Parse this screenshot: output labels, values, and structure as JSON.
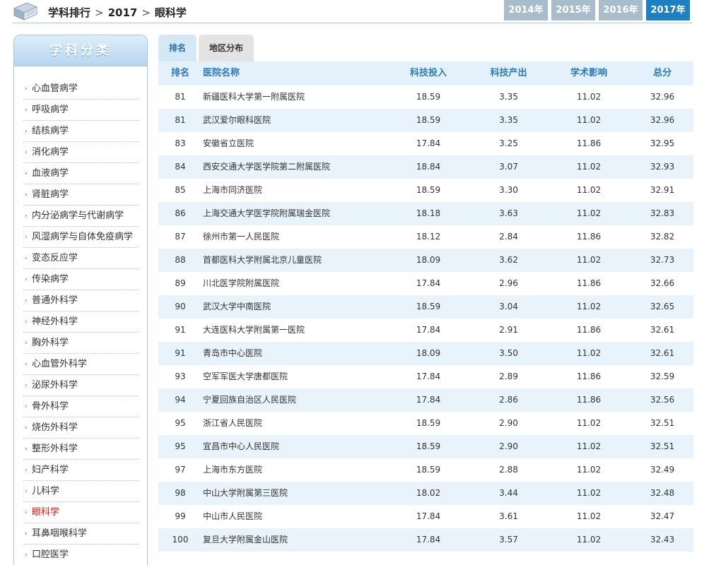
{
  "breadcrumb": {
    "items": [
      "学科排行",
      "2017",
      "眼科学"
    ],
    "separator": ">"
  },
  "years": [
    {
      "label": "2014年",
      "active": false
    },
    {
      "label": "2015年",
      "active": false
    },
    {
      "label": "2016年",
      "active": false
    },
    {
      "label": "2017年",
      "active": true
    }
  ],
  "sidebar": {
    "title": "学科分类",
    "items": [
      {
        "label": "心血管病学",
        "active": false
      },
      {
        "label": "呼吸病学",
        "active": false
      },
      {
        "label": "结核病学",
        "active": false
      },
      {
        "label": "消化病学",
        "active": false
      },
      {
        "label": "血液病学",
        "active": false
      },
      {
        "label": "肾脏病学",
        "active": false
      },
      {
        "label": "内分泌病学与代谢病学",
        "active": false
      },
      {
        "label": "风湿病学与自体免疫病学",
        "active": false
      },
      {
        "label": "变态反应学",
        "active": false
      },
      {
        "label": "传染病学",
        "active": false
      },
      {
        "label": "普通外科学",
        "active": false
      },
      {
        "label": "神经外科学",
        "active": false
      },
      {
        "label": "胸外科学",
        "active": false
      },
      {
        "label": "心血管外科学",
        "active": false
      },
      {
        "label": "泌尿外科学",
        "active": false
      },
      {
        "label": "骨外科学",
        "active": false
      },
      {
        "label": "烧伤外科学",
        "active": false
      },
      {
        "label": "整形外科学",
        "active": false
      },
      {
        "label": "妇产科学",
        "active": false
      },
      {
        "label": "儿科学",
        "active": false
      },
      {
        "label": "眼科学",
        "active": true
      },
      {
        "label": "耳鼻咽喉科学",
        "active": false
      },
      {
        "label": "口腔医学",
        "active": false
      }
    ]
  },
  "tabs": [
    {
      "label": "排名",
      "active": true
    },
    {
      "label": "地区分布",
      "active": false
    }
  ],
  "table": {
    "headers": {
      "rank": "排名",
      "name": "医院名称",
      "investment": "科技投入",
      "output": "科技产出",
      "impact": "学术影响",
      "total": "总分"
    },
    "rows": [
      {
        "rank": "81",
        "name": "新疆医科大学第一附属医院",
        "investment": "18.59",
        "output": "3.35",
        "impact": "11.02",
        "total": "32.96"
      },
      {
        "rank": "81",
        "name": "武汉爱尔眼科医院",
        "investment": "18.59",
        "output": "3.35",
        "impact": "11.02",
        "total": "32.96"
      },
      {
        "rank": "83",
        "name": "安徽省立医院",
        "investment": "17.84",
        "output": "3.25",
        "impact": "11.86",
        "total": "32.95"
      },
      {
        "rank": "84",
        "name": "西安交通大学医学院第二附属医院",
        "investment": "18.84",
        "output": "3.07",
        "impact": "11.02",
        "total": "32.93"
      },
      {
        "rank": "85",
        "name": "上海市同济医院",
        "investment": "18.59",
        "output": "3.30",
        "impact": "11.02",
        "total": "32.91"
      },
      {
        "rank": "86",
        "name": "上海交通大学医学院附属瑞金医院",
        "investment": "18.18",
        "output": "3.63",
        "impact": "11.02",
        "total": "32.83"
      },
      {
        "rank": "87",
        "name": "徐州市第一人民医院",
        "investment": "18.12",
        "output": "2.84",
        "impact": "11.86",
        "total": "32.82"
      },
      {
        "rank": "88",
        "name": "首都医科大学附属北京儿童医院",
        "investment": "18.09",
        "output": "3.62",
        "impact": "11.02",
        "total": "32.73"
      },
      {
        "rank": "89",
        "name": "川北医学院附属医院",
        "investment": "17.84",
        "output": "2.96",
        "impact": "11.86",
        "total": "32.66"
      },
      {
        "rank": "90",
        "name": "武汉大学中南医院",
        "investment": "18.59",
        "output": "3.04",
        "impact": "11.02",
        "total": "32.65"
      },
      {
        "rank": "91",
        "name": "大连医科大学附属第一医院",
        "investment": "17.84",
        "output": "2.91",
        "impact": "11.86",
        "total": "32.61"
      },
      {
        "rank": "91",
        "name": "青岛市中心医院",
        "investment": "18.09",
        "output": "3.50",
        "impact": "11.02",
        "total": "32.61"
      },
      {
        "rank": "93",
        "name": "空军军医大学唐都医院",
        "investment": "17.84",
        "output": "2.89",
        "impact": "11.86",
        "total": "32.59"
      },
      {
        "rank": "94",
        "name": "宁夏回族自治区人民医院",
        "investment": "17.84",
        "output": "2.86",
        "impact": "11.86",
        "total": "32.56"
      },
      {
        "rank": "95",
        "name": "浙江省人民医院",
        "investment": "18.59",
        "output": "2.90",
        "impact": "11.02",
        "total": "32.51"
      },
      {
        "rank": "95",
        "name": "宜昌市中心人民医院",
        "investment": "18.59",
        "output": "2.90",
        "impact": "11.02",
        "total": "32.51"
      },
      {
        "rank": "97",
        "name": "上海市东方医院",
        "investment": "18.59",
        "output": "2.88",
        "impact": "11.02",
        "total": "32.49"
      },
      {
        "rank": "98",
        "name": "中山大学附属第三医院",
        "investment": "18.02",
        "output": "3.44",
        "impact": "11.02",
        "total": "32.48"
      },
      {
        "rank": "99",
        "name": "中山市人民医院",
        "investment": "17.84",
        "output": "3.61",
        "impact": "11.02",
        "total": "32.47"
      },
      {
        "rank": "100",
        "name": "复旦大学附属金山医院",
        "investment": "17.84",
        "output": "3.57",
        "impact": "11.02",
        "total": "32.43"
      }
    ]
  },
  "colors": {
    "accent": "#1e7fc2",
    "header_text": "#2a7ab8",
    "active_link": "#e0120f",
    "stripe": "#e8f3fb"
  }
}
